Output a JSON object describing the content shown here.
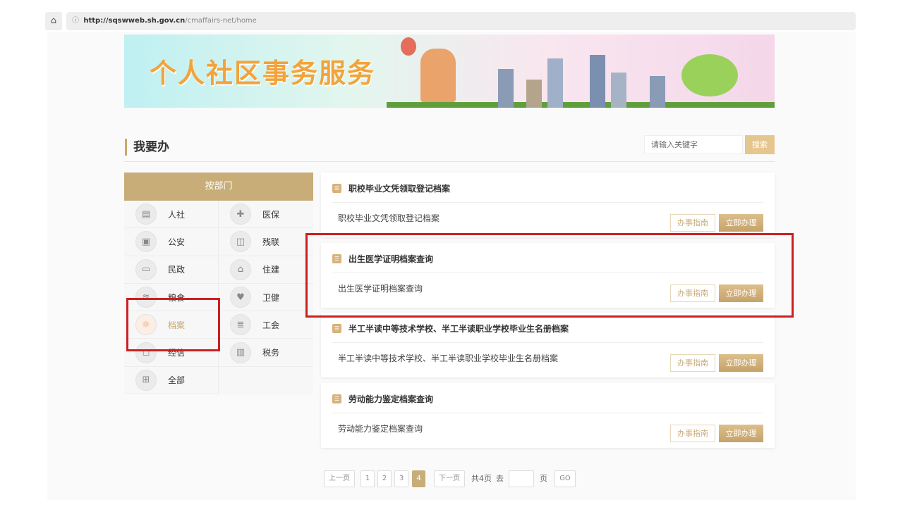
{
  "browser": {
    "url_host": "http://sqswweb.sh.gov.cn",
    "url_path": "/cmaffairs-net/home"
  },
  "banner": {
    "title": "个人社区事务服务"
  },
  "section": {
    "title": "我要办"
  },
  "search": {
    "placeholder": "请输入关键字",
    "button": "搜索"
  },
  "dept": {
    "header": "按部门",
    "items": [
      {
        "label": "人社",
        "icon": "certificate-icon"
      },
      {
        "label": "医保",
        "icon": "medical-kit-icon"
      },
      {
        "label": "公安",
        "icon": "id-card-icon"
      },
      {
        "label": "残联",
        "icon": "book-icon"
      },
      {
        "label": "民政",
        "icon": "id-badge-icon"
      },
      {
        "label": "住建",
        "icon": "building-icon"
      },
      {
        "label": "粮食",
        "icon": "grain-icon"
      },
      {
        "label": "卫健",
        "icon": "heart-hands-icon"
      },
      {
        "label": "档案",
        "icon": "lightbulb-icon",
        "active": true
      },
      {
        "label": "工会",
        "icon": "layers-icon"
      },
      {
        "label": "经信",
        "icon": "shield-icon"
      },
      {
        "label": "税务",
        "icon": "tax-doc-icon"
      },
      {
        "label": "全部",
        "icon": "grid-icon"
      }
    ]
  },
  "cards": [
    {
      "title": "职校毕业文凭领取登记档案",
      "body": "职校毕业文凭领取登记档案",
      "guide": "办事指南",
      "action": "立即办理"
    },
    {
      "title": "出生医学证明档案查询",
      "body": "出生医学证明档案查询",
      "guide": "办事指南",
      "action": "立即办理"
    },
    {
      "title": "半工半读中等技术学校、半工半读职业学校毕业生名册档案",
      "body": "半工半读中等技术学校、半工半读职业学校毕业生名册档案",
      "guide": "办事指南",
      "action": "立即办理"
    },
    {
      "title": "劳动能力鉴定档案查询",
      "body": "劳动能力鉴定档案查询",
      "guide": "办事指南",
      "action": "立即办理"
    }
  ],
  "pager": {
    "prev": "上一页",
    "pages": [
      "1",
      "2",
      "3",
      "4"
    ],
    "current": "4",
    "next": "下一页",
    "total": "共4页",
    "goto": "去",
    "page_unit": "页",
    "go": "GO"
  }
}
